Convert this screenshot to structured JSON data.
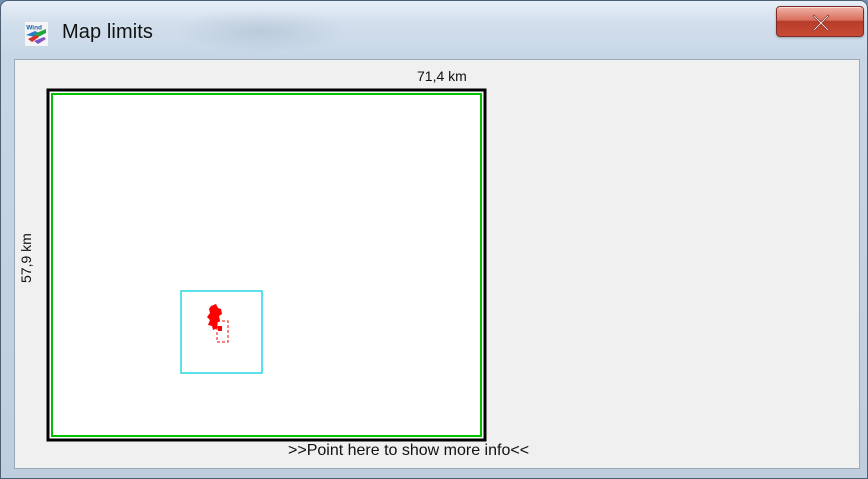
{
  "window": {
    "title": "Map limits",
    "close_icon": "close-icon",
    "app_icon": "windpro-icon"
  },
  "map": {
    "width_label": "71,4 km",
    "height_label": "57,9 km",
    "info_text": ">>Point here to show more info<<",
    "colors": {
      "outer_frame": "#000000",
      "inner_frame": "#00c000",
      "focus_box": "#26d7e3",
      "site_marker": "#ff0000",
      "dashed_marker": "#ff0000"
    }
  }
}
